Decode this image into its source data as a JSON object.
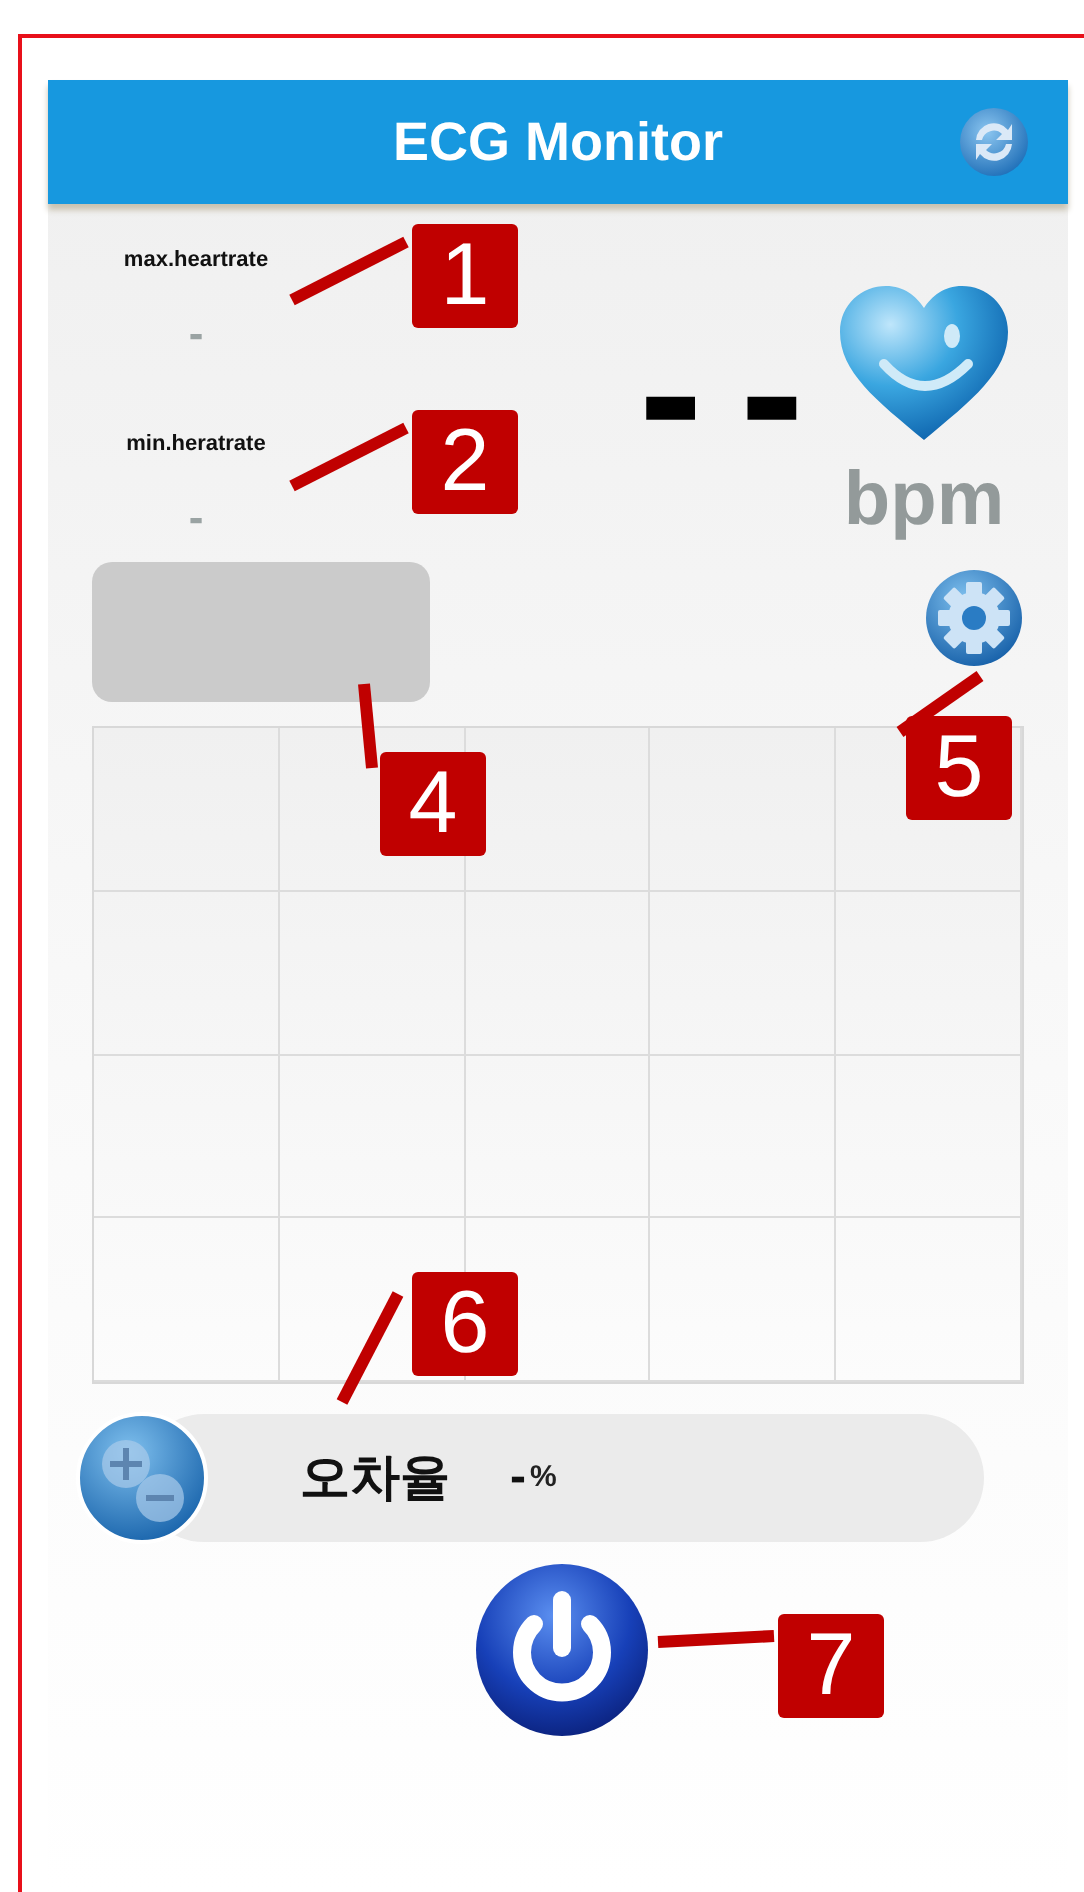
{
  "app_bar": {
    "title": "ECG Monitor"
  },
  "stats": [
    {
      "label": "max.heartrate",
      "value": "-"
    },
    {
      "label": "min.heratrate",
      "value": "-"
    }
  ],
  "heart_rate": {
    "value": "- -",
    "unit": "bpm"
  },
  "error_rate": {
    "label": "오차율",
    "value": "-",
    "unit": "%"
  },
  "callouts": [
    "1",
    "2",
    "4",
    "5",
    "6",
    "7"
  ]
}
